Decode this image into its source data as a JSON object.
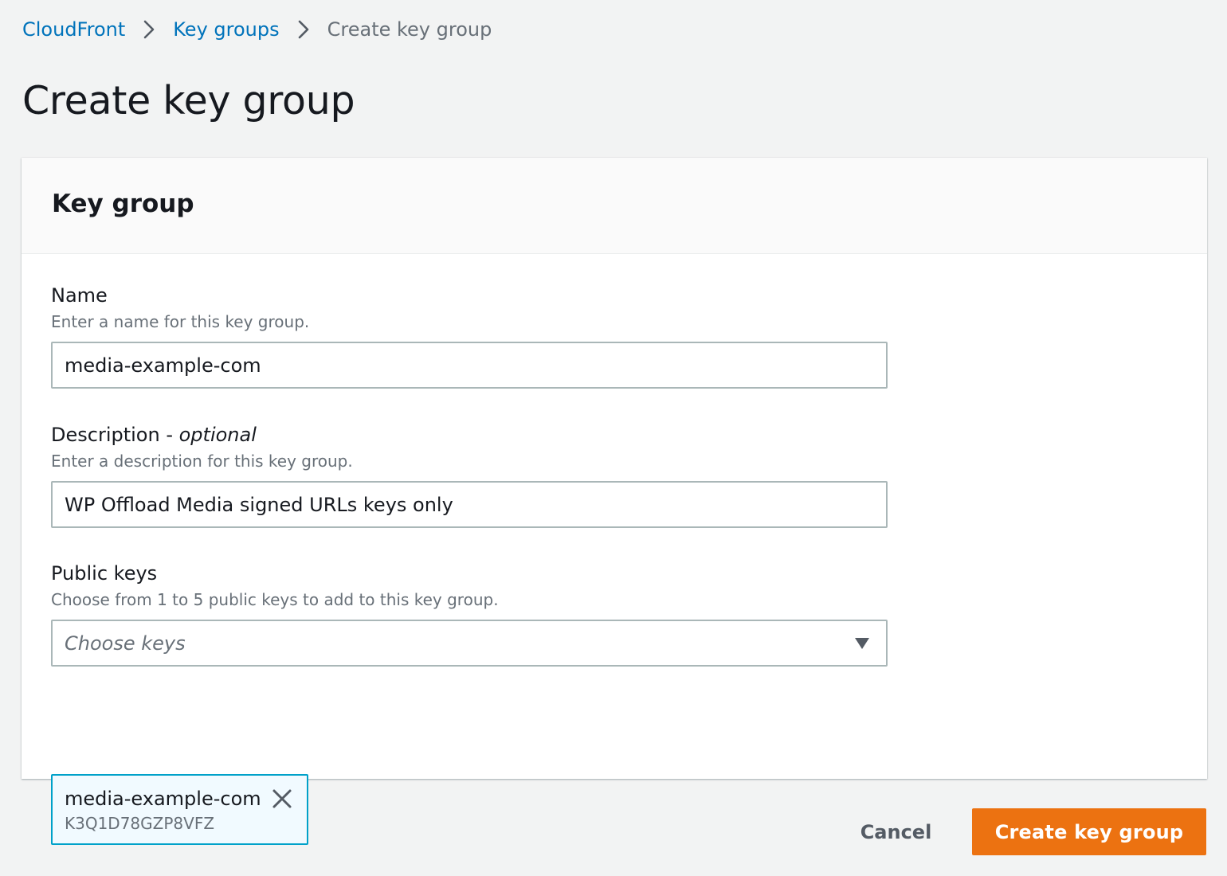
{
  "breadcrumb": {
    "items": [
      {
        "label": "CloudFront",
        "link": true
      },
      {
        "label": "Key groups",
        "link": true
      },
      {
        "label": "Create key group",
        "link": false
      }
    ]
  },
  "page": {
    "title": "Create key group"
  },
  "card": {
    "title": "Key group",
    "name_field": {
      "label": "Name",
      "description": "Enter a name for this key group.",
      "value": "media-example-com"
    },
    "description_field": {
      "label": "Description - ",
      "label_optional": "optional",
      "description": "Enter a description for this key group.",
      "value": "WP Offload Media signed URLs keys only"
    },
    "public_keys_field": {
      "label": "Public keys",
      "description": "Choose from 1 to 5 public keys to add to this key group.",
      "placeholder": "Choose keys"
    },
    "selected_keys": [
      {
        "name": "media-example-com",
        "id": "K3Q1D78GZP8VFZ"
      }
    ]
  },
  "actions": {
    "cancel_label": "Cancel",
    "submit_label": "Create key group"
  },
  "icons": {
    "breadcrumb_separator": "chevron-right-icon",
    "select_caret": "caret-down-icon",
    "token_remove": "close-icon"
  },
  "colors": {
    "link": "#0073bb",
    "primary_button": "#ec7211",
    "token_border": "#00a1c9",
    "token_background": "#f1faff",
    "page_background": "#f2f3f3"
  }
}
